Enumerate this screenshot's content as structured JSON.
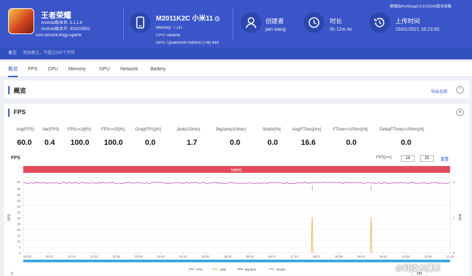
{
  "header": {
    "app": {
      "name": "王者荣耀",
      "android_version": "Android版本名: 3.1.1.6",
      "android_code": "Android版本号: 301010601",
      "package": "com.tencent.tmgp.sgame"
    },
    "device": {
      "model": "M2011K2C 小米11",
      "memory": "Memory: 7.1G",
      "cpu": "CPU: lahaina",
      "gpu": "GPU: Qualcomm Adreno (TM) 660"
    },
    "creator": {
      "label": "创建者",
      "value": "jian wang"
    },
    "duration": {
      "label": "时长",
      "value": "0h 12m 4s"
    },
    "upload": {
      "label": "上传时间",
      "value": "15/01/2021 18:23:50"
    },
    "version_note": "数据由PerfDog(5.0.210104)版本收集",
    "remark_label": "备注:",
    "remark_placeholder": "添加备注，不超过200个字符"
  },
  "tabs": [
    "概览",
    "FPS",
    "CPU",
    "Memory",
    "GPU",
    "Network",
    "Battery"
  ],
  "overview": {
    "title": "概览",
    "export_label": "导出全部"
  },
  "fps_section": {
    "title": "FPS"
  },
  "metrics": [
    {
      "label": "Avg(FPS)",
      "value": "60.0"
    },
    {
      "label": "Var(FPS)",
      "value": "0.4"
    },
    {
      "label": "FPS>=18[%]",
      "value": "100.0"
    },
    {
      "label": "FPS>=25[%]",
      "value": "100.0"
    },
    {
      "label": "Drop(FPS)[/h]",
      "value": "0.0"
    },
    {
      "label": "Jank(/10min)",
      "value": "1.7"
    },
    {
      "label": "BigJank(/10min)",
      "value": "0.0"
    },
    {
      "label": "Stutter[%]",
      "value": "0.0"
    },
    {
      "label": "Avg(FTime)[ms]",
      "value": "16.6"
    },
    {
      "label": "FTime>=100ms[%]",
      "value": "0.0"
    },
    {
      "label": "Delta(FTime)>100ms[/h]",
      "value": "0.0"
    }
  ],
  "chart_controls": {
    "chart_title": "FPS",
    "threshold_label": "FPS(>=)",
    "threshold_1": "18",
    "threshold_2": "25",
    "reset_label": "重置",
    "range_label": "label1",
    "bottom_left": "0",
    "bottom_value": "100"
  },
  "colors": {
    "header_bg": "#3a55c8",
    "accent": "#3a55c8",
    "fps_line": "#b03ab0",
    "jank": "#e8a03c",
    "label_bar": "#e34b5c",
    "scrollbar": "#3fa7dc"
  },
  "chart_data": {
    "type": "line",
    "x_ticks": [
      "00:00",
      "00:37",
      "01:14",
      "01:51",
      "02:28",
      "03:05",
      "03:42",
      "04:19",
      "04:56",
      "05:33",
      "06:10",
      "06:47",
      "07:24",
      "08:01",
      "08:38",
      "09:15",
      "09:52",
      "10:29",
      "11:06",
      "11:43"
    ],
    "y_ticks_left": [
      0,
      5,
      10,
      15,
      20,
      25,
      30,
      35,
      40,
      45,
      50,
      55,
      61
    ],
    "ylim_left": [
      0,
      61
    ],
    "ylabel_left": "FPS",
    "y_ticks_right": [
      0,
      1,
      2
    ],
    "ylim_right": [
      0,
      2
    ],
    "ylabel_right": "Jank",
    "xlim_seconds": [
      0,
      724
    ],
    "series": [
      {
        "name": "FPS",
        "axis": "left",
        "approx_value": 60,
        "variation": 0.6
      },
      {
        "name": "Jank",
        "axis": "right",
        "events_at_seconds": [
          490,
          590
        ],
        "event_value": 1
      },
      {
        "name": "BigJank",
        "axis": "right",
        "events_at_seconds": []
      },
      {
        "name": "Stutter",
        "axis": "right",
        "events_at_seconds": []
      }
    ],
    "legend": [
      "FPS",
      "Jank",
      "BigJank",
      "Stutter"
    ],
    "legend_position": "bottom"
  },
  "watermark": "@科技大犍哥"
}
